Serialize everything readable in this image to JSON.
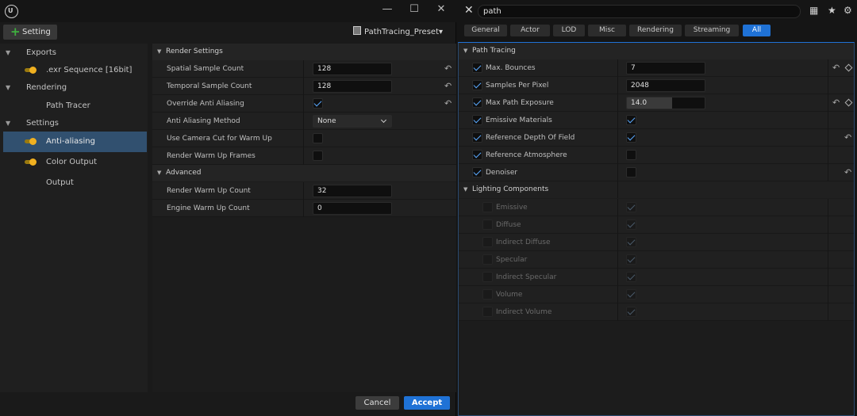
{
  "left_window": {
    "logo": "U",
    "controls": {
      "minimize": "—",
      "maximize": "☐",
      "close": "✕"
    },
    "toolbar": {
      "setting_label": "Setting",
      "preset_label": "PathTracing_Preset▾"
    },
    "sidebar": {
      "exports_label": "Exports",
      "exr_label": ".exr Sequence [16bit]",
      "rendering_label": "Rendering",
      "path_tracer_label": "Path Tracer",
      "settings_label": "Settings",
      "anti_aliasing_label": "Anti-aliasing",
      "color_output_label": "Color Output",
      "output_label": "Output"
    },
    "details": {
      "render_settings_label": "Render Settings",
      "spatial_label": "Spatial Sample Count",
      "spatial_value": "128",
      "temporal_label": "Temporal Sample Count",
      "temporal_value": "128",
      "override_aa_label": "Override Anti Aliasing",
      "override_aa_checked": true,
      "aa_method_label": "Anti Aliasing Method",
      "aa_method_value": "None",
      "camera_cut_label": "Use Camera Cut for Warm Up",
      "camera_cut_checked": false,
      "render_warmup_frames_label": "Render Warm Up Frames",
      "render_warmup_frames_checked": false,
      "advanced_label": "Advanced",
      "render_warmup_count_label": "Render Warm Up Count",
      "render_warmup_count_value": "32",
      "engine_warmup_count_label": "Engine Warm Up Count",
      "engine_warmup_count_value": "0"
    },
    "footer": {
      "cancel_label": "Cancel",
      "accept_label": "Accept"
    }
  },
  "right_panel": {
    "search": {
      "value": "path"
    },
    "filter_tabs": [
      "General",
      "Actor",
      "LOD",
      "Misc",
      "Rendering",
      "Streaming",
      "All"
    ],
    "active_tab": "All",
    "path_tracing_label": "Path Tracing",
    "max_bounces_label": "Max. Bounces",
    "max_bounces_value": "7",
    "spp_label": "Samples Per Pixel",
    "spp_value": "2048",
    "max_exposure_label": "Max Path Exposure",
    "max_exposure_value": "14.0",
    "max_exposure_fill": 0.58,
    "emissive_materials_label": "Emissive Materials",
    "ref_dof_label": "Reference Depth Of Field",
    "ref_atmosphere_label": "Reference Atmosphere",
    "denoiser_label": "Denoiser",
    "lighting_components_label": "Lighting Components",
    "lc_emissive_label": "Emissive",
    "lc_diffuse_label": "Diffuse",
    "lc_indirect_diffuse_label": "Indirect Diffuse",
    "lc_specular_label": "Specular",
    "lc_indirect_specular_label": "Indirect Specular",
    "lc_volume_label": "Volume",
    "lc_indirect_volume_label": "Indirect Volume"
  },
  "colors": {
    "accent": "#1f72d6",
    "selection": "#31506f",
    "toggle": "#f0b020",
    "plus": "#3fb03f"
  },
  "icons": [
    "unreal-logo-icon",
    "minimize-icon",
    "maximize-icon",
    "close-icon",
    "plus-icon",
    "preset-icon",
    "toggle-icon",
    "reset-arrow-icon",
    "dropdown-chevron-icon",
    "keyframe-diamond-icon",
    "table-view-icon",
    "star-icon",
    "gear-icon"
  ]
}
